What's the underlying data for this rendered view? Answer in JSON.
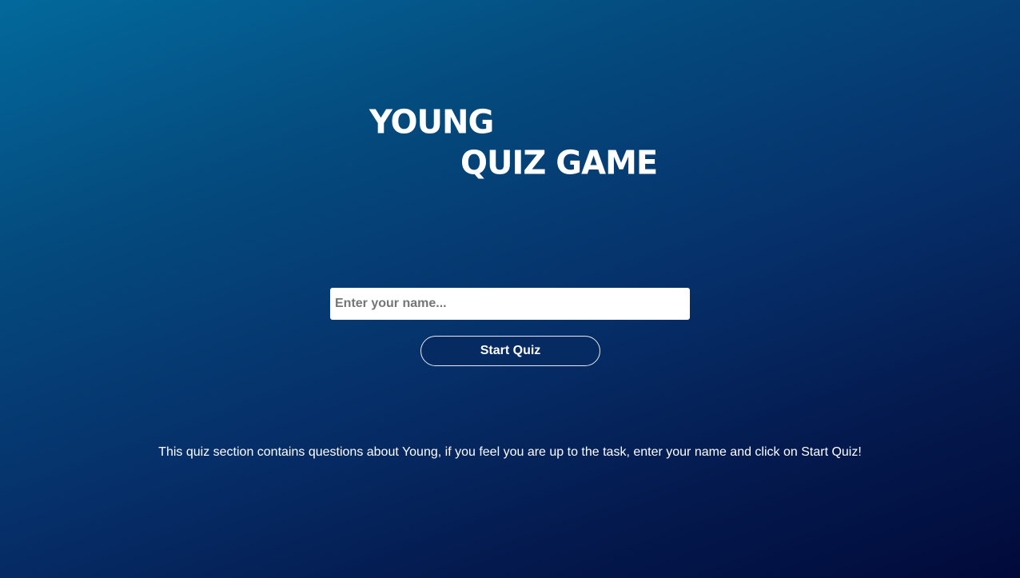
{
  "logo": {
    "line1": "YOUNG",
    "line2": "QUIZ GAME"
  },
  "form": {
    "name_placeholder": "Enter your name...",
    "name_value": "",
    "start_label": "Start Quiz"
  },
  "description": "This quiz section contains questions about Young, if you feel you are up to the task, enter your name and click on Start Quiz!",
  "colors": {
    "background_start": "#03699c",
    "background_end": "#010a3a",
    "button_background": "#062a62",
    "text": "#ffffff"
  }
}
